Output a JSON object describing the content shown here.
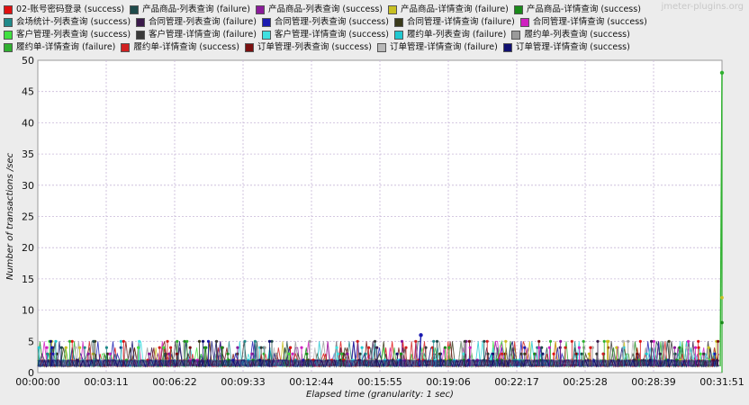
{
  "watermark": "jmeter-plugins.org",
  "chart_data": {
    "type": "line",
    "title": "",
    "xlabel": "Elapsed time (granularity: 1 sec)",
    "ylabel": "Number of transactions /sec",
    "ylim": [
      0,
      50
    ],
    "yticks": [
      0,
      5,
      10,
      15,
      20,
      25,
      30,
      35,
      40,
      45,
      50
    ],
    "xlim_seconds": [
      0,
      1911
    ],
    "xticks": [
      "00:00:00",
      "00:03:11",
      "00:06:22",
      "00:09:33",
      "00:12:44",
      "00:15:55",
      "00:19:06",
      "00:22:17",
      "00:25:28",
      "00:28:39",
      "00:31:51"
    ],
    "grid": true,
    "legend_position": "top",
    "legend_rows": [
      [
        {
          "name": "02-账号密码登录 (success)",
          "color": "#e01010"
        },
        {
          "name": "产品商品-列表查询 (failure)",
          "color": "#1e4a4a"
        },
        {
          "name": "产品商品-列表查询 (success)",
          "color": "#8a1a9a"
        },
        {
          "name": "产品商品-详情查询 (failure)",
          "color": "#c8c020"
        },
        {
          "name": "产品商品-详情查询 (success)",
          "color": "#1a8a1a"
        }
      ],
      [
        {
          "name": "会场统计-列表查询 (success)",
          "color": "#208a8a"
        },
        {
          "name": "合同管理-列表查询 (failure)",
          "color": "#3a1a4a"
        },
        {
          "name": "合同管理-列表查询 (success)",
          "color": "#1a1ab0"
        },
        {
          "name": "合同管理-详情查询 (failure)",
          "color": "#3a3a1a"
        },
        {
          "name": "合同管理-详情查询 (success)",
          "color": "#d020c0"
        }
      ],
      [
        {
          "name": "客户管理-列表查询 (success)",
          "color": "#40e040"
        },
        {
          "name": "客户管理-详情查询 (failure)",
          "color": "#3a3a3a"
        },
        {
          "name": "客户管理-详情查询 (success)",
          "color": "#40e0e0"
        },
        {
          "name": "履约单-列表查询 (failure)",
          "color": "#20c8d0"
        },
        {
          "name": "履约单-列表查询 (success)",
          "color": "#9a9a9a"
        }
      ],
      [
        {
          "name": "履约单-详情查询 (failure)",
          "color": "#30b030"
        },
        {
          "name": "履约单-详情查询 (success)",
          "color": "#d02020"
        },
        {
          "name": "订单管理-列表查询 (success)",
          "color": "#7a1010"
        },
        {
          "name": "订单管理-详情查询 (failure)",
          "color": "#b8b8b8"
        },
        {
          "name": "订单管理-详情查询 (success)",
          "color": "#101070"
        }
      ]
    ],
    "notable_points": [
      {
        "series": "履约单-详情查询 (failure)",
        "x": "00:31:51",
        "y": 48
      },
      {
        "series": "合同管理-列表查询 (success)",
        "x": "00:17:50",
        "y": 6
      }
    ],
    "baseline_range": [
      1,
      5
    ]
  }
}
